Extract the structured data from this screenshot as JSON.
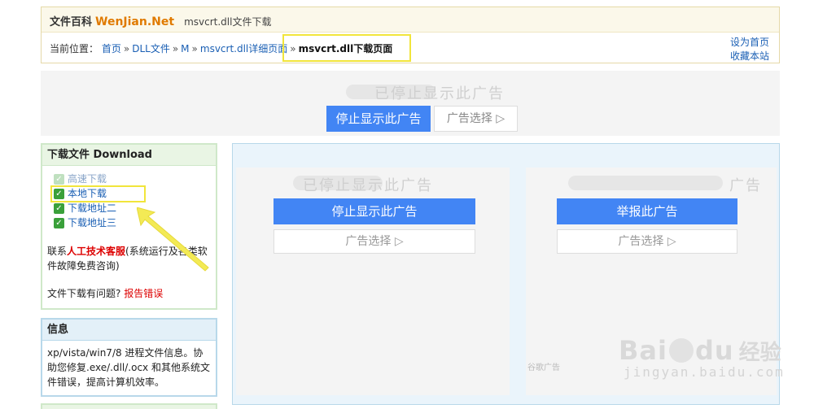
{
  "header": {
    "site_name": "文件百科",
    "brand": "WenJian.Net",
    "subtitle": "msvcrt.dll文件下载",
    "breadcrumb_label": "当前位置：",
    "breadcrumb": [
      "首页",
      "DLL文件",
      "M",
      "msvcrt.dll详细页面"
    ],
    "breadcrumb_sep": "»",
    "breadcrumb_current": "msvcrt.dll下载页面",
    "link_homepage": "设为首页",
    "link_bookmark": "收藏本站"
  },
  "top_ad": {
    "ghost_text": "已停止显示此广告",
    "stop_button": "停止显示此广告",
    "choice_button": "广告选择 ▷"
  },
  "download_panel": {
    "title": "下载文件 Download",
    "items": [
      {
        "label": "高速下载"
      },
      {
        "label": "本地下载"
      },
      {
        "label": "下载地址二"
      },
      {
        "label": "下载地址三"
      }
    ],
    "contact_prefix": "联系",
    "contact_link": "人工技术客服",
    "contact_suffix": "(系统运行及各类软件故障免费咨询)",
    "problem_text": "文件下载有问题?",
    "problem_link": "报告错误"
  },
  "info_panel": {
    "title": "信息",
    "text": "xp/vista/win7/8 进程文件信息。协助您修复.exe/.dll/.ocx 和其他系统文件错误，提高计算机效率。"
  },
  "main_ads": {
    "slot1": {
      "ghost_text": "已停止显示此广告",
      "button": "停止显示此广告",
      "choice": "广告选择 ▷"
    },
    "slot2": {
      "ghost_text": "广告",
      "button": "举报此广告",
      "choice": "广告选择 ▷",
      "footer": "谷歌广告"
    }
  },
  "watermark": {
    "logo_left": "Bai",
    "logo_right": "du",
    "logo_cn": "经验",
    "url": "jingyan.baidu.com"
  },
  "colors": {
    "ad_blue": "#4285f4",
    "highlight_yellow": "#f1e53b",
    "link_blue": "#1a5fb4",
    "alert_red": "#dd0000"
  }
}
